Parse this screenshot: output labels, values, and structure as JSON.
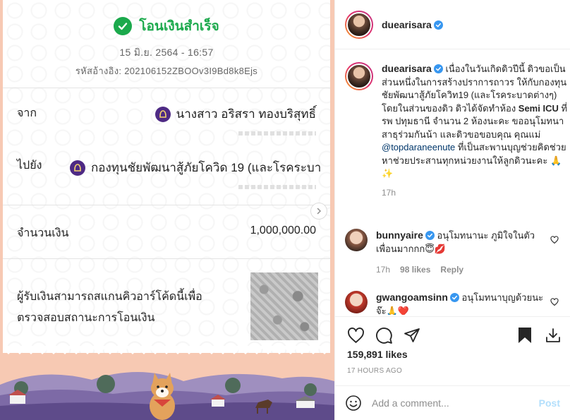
{
  "slip": {
    "status": "โอนเงินสำเร็จ",
    "datetime": "15 มิ.ย. 2564 - 16:57",
    "reference": "รหัสอ้างอิง: 202106152ZBOOv3I9Bd8k8Ejs",
    "from_label": "จาก",
    "from_name": "นางสาว อริสรา ทองบริสุทธิ์",
    "to_label": "ไปยัง",
    "to_name": "กองทุนชัยพัฒนาสู้ภัยโควิด 19 (และโรคระบา",
    "amount_label": "จำนวนเงิน",
    "amount": "1,000,000.00",
    "qr_text": "ผู้รับเงินสามารถสแกนคิวอาร์โค้ดนี้เพื่อตรวจสอบสถานะการโอนเงิน"
  },
  "post": {
    "username": "duearisara",
    "caption_before": "เนื่องในวันเกิดดิวปีนี้ ดิวขอเป็นส่วนหนึ่งในการสร้างปราการถาวร ให้กับกองทุนชัยพัฒนาสู้ภัยโควิท19 (และโรคระบาดต่างๆ) โดยในส่วนของดิว ดิวได้จัดทำห้อง ",
    "caption_bold": "Semi ICU",
    "caption_middle": " ที่รพ ปทุมธานี จำนวน 2 ห้องนะคะ ขออนุโมทนาสาธุร่วมกันน้า และดิวขอขอบคุณ คุณแม่ ",
    "caption_mention": "@topdaraneenute",
    "caption_after": " ที่เป็นสะพานบุญช่วยคิดช่วยหาช่วยประสานทุกหน่วยงานให้ลูกดิวนะคะ 🙏✨",
    "caption_time": "17h",
    "likes": "159,891 likes",
    "posted_ago": "17 HOURS AGO"
  },
  "comments": [
    {
      "username": "bunnyaire",
      "text": "อนุโมทนานะ ภูมิใจในตัวเพื่อนมากกก😇💋",
      "time": "17h",
      "likes": "98 likes",
      "reply": "Reply"
    },
    {
      "username": "gwangoamsinn",
      "text": "อนุโมทนาบุญด้วยนะจ๊ะ🙏❤️"
    }
  ],
  "comment_box": {
    "placeholder": "Add a comment...",
    "post_label": "Post"
  },
  "colors": {
    "success_green": "#1ba94c",
    "bank_purple": "#4e2a84",
    "instagram_blue": "#0095f6",
    "verified_blue": "#3897f0"
  },
  "icons": [
    "check-icon",
    "bank-logo-icon",
    "chevron-right-icon",
    "verified-icon",
    "heart-icon",
    "comment-icon",
    "share-icon",
    "bookmark-icon",
    "download-icon",
    "emoji-icon"
  ]
}
